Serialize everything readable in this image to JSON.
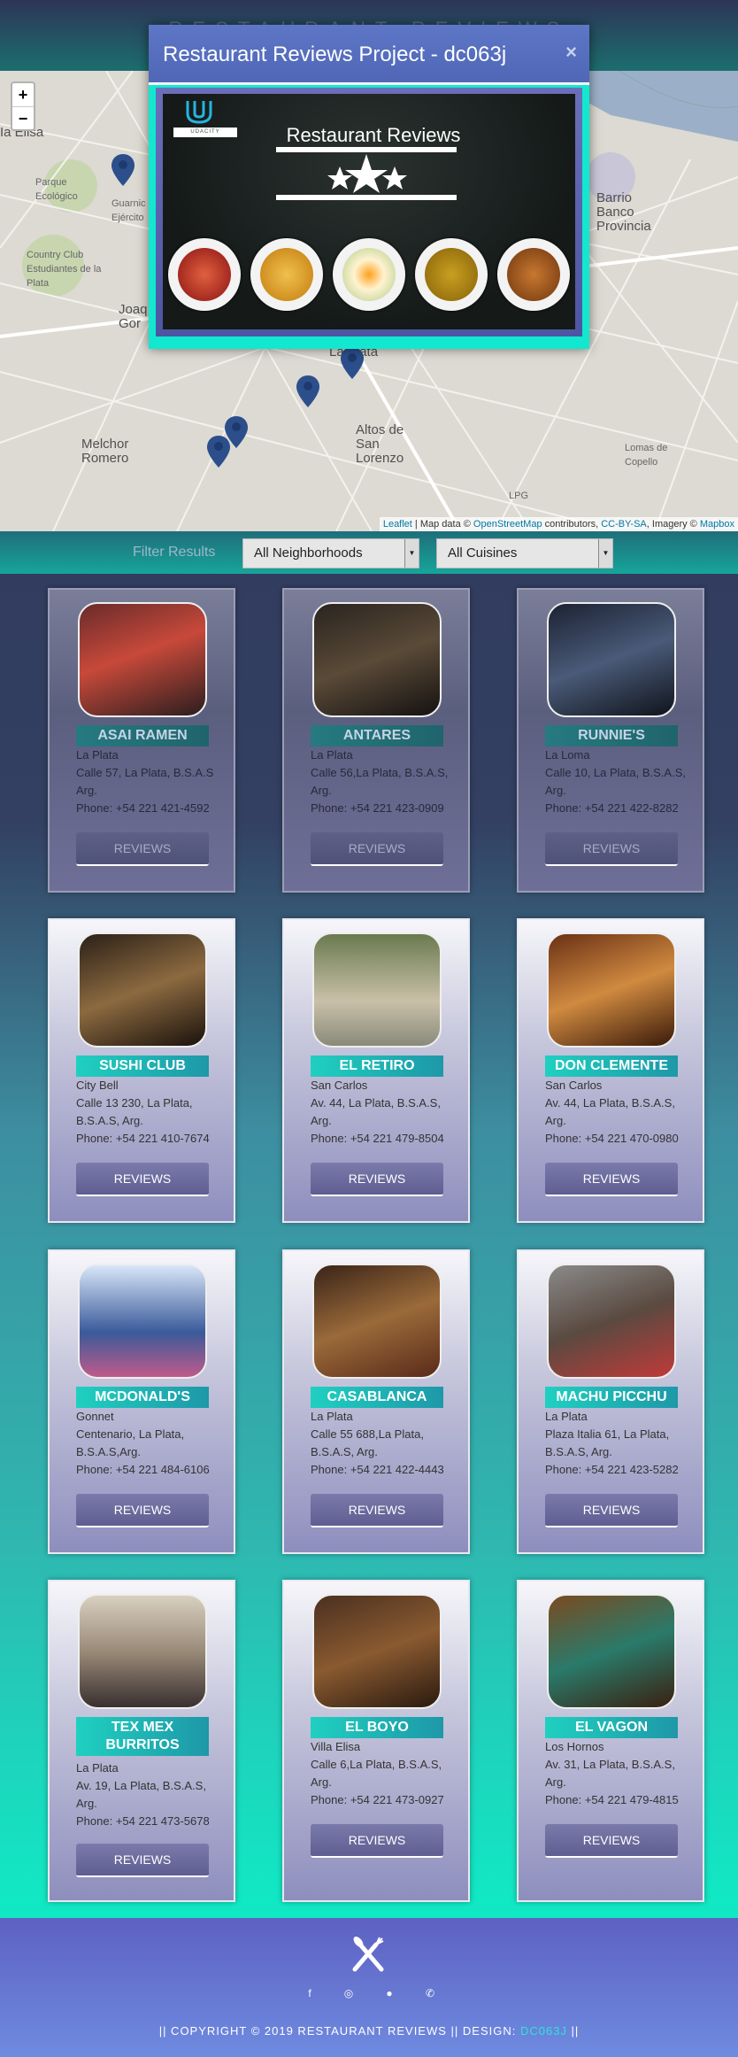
{
  "header": {
    "title": "RESTAURANT REVIEWS"
  },
  "map": {
    "zoom_in": "+",
    "zoom_out": "−",
    "places": [
      "Ia Elisa",
      "Parque Ecológico",
      "Guarnic Ejército",
      "Country Club Estudiantes de la Plata",
      "Joaq Gor",
      "La Plata",
      "Barrio Banco Provincia",
      "Melchor Romero",
      "Altos de San Lorenzo",
      "Lomas de Copello",
      "LPG"
    ],
    "attribution": {
      "leaflet": "Leaflet",
      "text1": " | Map data © ",
      "osm": "OpenStreetMap",
      "text2": " contributors, ",
      "ccbysa": "CC-BY-SA",
      "text3": ", Imagery © ",
      "mapbox": "Mapbox"
    }
  },
  "filter": {
    "label": "Filter Results",
    "neighborhoods": "All Neighborhoods",
    "cuisines": "All Cuisines"
  },
  "modal": {
    "title": "Restaurant Reviews Project - dc063j",
    "close": "×",
    "banner_title": "Restaurant Reviews",
    "banner_brand": "UDACITY"
  },
  "restaurants": [
    {
      "name": "ASAI RAMEN",
      "neighborhood": "La Plata",
      "address": "Calle 57, La Plata, B.S.A.S Arg.",
      "phone": "Phone: +54 221 421-4592",
      "button": "REVIEWS"
    },
    {
      "name": "ANTARES",
      "neighborhood": "La Plata",
      "address": "Calle 56,La Plata, B.S.A.S, Arg.",
      "phone": "Phone: +54 221 423-0909",
      "button": "REVIEWS"
    },
    {
      "name": "RUNNIE'S",
      "neighborhood": "La Loma",
      "address": "Calle 10, La Plata, B.S.A.S, Arg.",
      "phone": "Phone: +54 221 422-8282",
      "button": "REVIEWS"
    },
    {
      "name": "SUSHI CLUB",
      "neighborhood": "City Bell",
      "address": "Calle 13 230, La Plata, B.S.A.S, Arg.",
      "phone": "Phone: +54 221 410-7674",
      "button": "REVIEWS"
    },
    {
      "name": "EL RETIRO",
      "neighborhood": "San Carlos",
      "address": "Av. 44, La Plata, B.S.A.S, Arg.",
      "phone": "Phone: +54 221 479-8504",
      "button": "REVIEWS"
    },
    {
      "name": "DON CLEMENTE",
      "neighborhood": "San Carlos",
      "address": "Av. 44, La Plata, B.S.A.S, Arg.",
      "phone": "Phone: +54 221 470-0980",
      "button": "REVIEWS"
    },
    {
      "name": "MCDONALD'S",
      "neighborhood": "Gonnet",
      "address": "Centenario, La Plata, B.S.A.S,Arg.",
      "phone": "Phone: +54 221 484-6106",
      "button": "REVIEWS"
    },
    {
      "name": "CASABLANCA",
      "neighborhood": "La Plata",
      "address": "Calle 55 688,La Plata, B.S.A.S, Arg.",
      "phone": "Phone: +54 221 422-4443",
      "button": "REVIEWS"
    },
    {
      "name": "MACHU PICCHU",
      "neighborhood": "La Plata",
      "address": "Plaza Italia 61, La Plata, B.S.A.S, Arg.",
      "phone": "Phone: +54 221 423-5282",
      "button": "REVIEWS"
    },
    {
      "name": "TEX MEX BURRITOS",
      "neighborhood": "La Plata",
      "address": "Av. 19, La Plata, B.S.A.S, Arg.",
      "phone": "Phone: +54 221 473-5678",
      "button": "REVIEWS"
    },
    {
      "name": "EL BOYO",
      "neighborhood": "Villa Elisa",
      "address": "Calle 6,La Plata, B.S.A.S, Arg.",
      "phone": "Phone: +54 221 473-0927",
      "button": "REVIEWS"
    },
    {
      "name": "EL VAGON",
      "neighborhood": "Los Hornos",
      "address": "Av. 31, La Plata, B.S.A.S, Arg.",
      "phone": "Phone: +54 221 479-4815",
      "button": "REVIEWS"
    }
  ],
  "footer": {
    "social_icons": [
      "facebook-icon",
      "instagram-icon",
      "github-icon",
      "whatsapp-icon"
    ],
    "copyright_prefix": "|| COPYRIGHT © 2019 RESTAURANT REVIEWS || DESIGN: ",
    "designer": "DC063J",
    "copyright_suffix": " ||"
  },
  "colors": {
    "accent": "#12e8d0",
    "modal_header": "#5e76c6",
    "footer": "#6f8be0"
  }
}
